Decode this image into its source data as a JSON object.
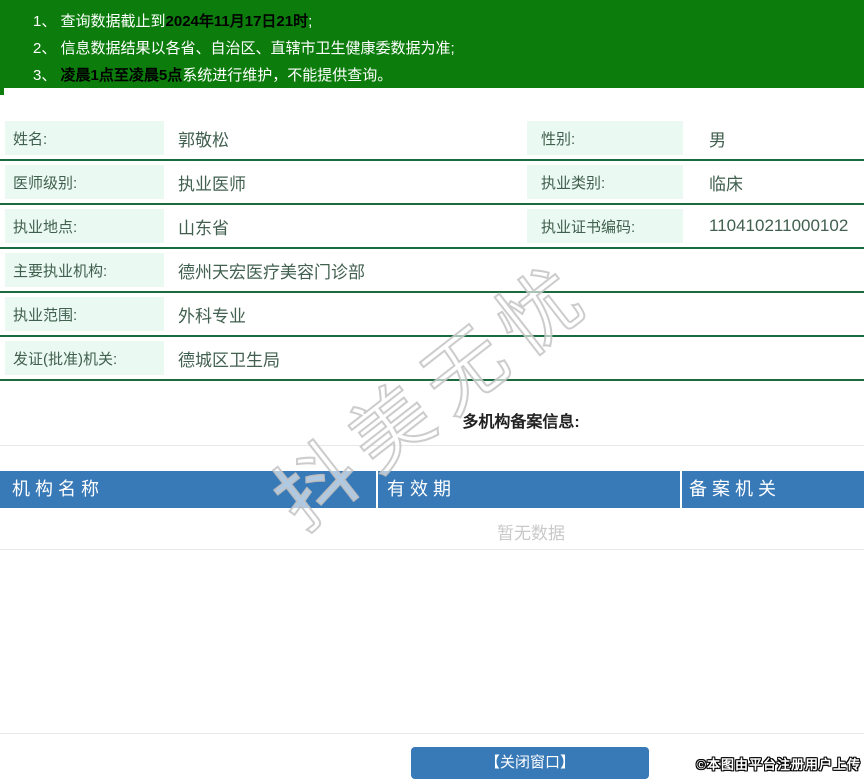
{
  "banner": {
    "items": [
      {
        "prefix": "1、 查询数据截止到",
        "bold": "2024年11月17日21时",
        "suffix": ";"
      },
      {
        "prefix": "2、 信息数据结果以各省、自治区、直辖市卫生健康委数据为准;",
        "bold": "",
        "suffix": ""
      },
      {
        "prefix": "3、 ",
        "bold": "凌晨1点至凌晨5点",
        "suffix": "系统进行维护，不能提供查询。"
      }
    ]
  },
  "doctor": {
    "name_label": "姓名:",
    "name_value": "郭敬松",
    "gender_label": "性别:",
    "gender_value": "男",
    "level_label": "医师级别:",
    "level_value": "执业医师",
    "category_label": "执业类别:",
    "category_value": "临床",
    "location_label": "执业地点:",
    "location_value": "山东省",
    "cert_label": "执业证书编码:",
    "cert_value": "110410211000102",
    "org_label": "主要执业机构:",
    "org_value": "德州天宏医疗美容门诊部",
    "scope_label": "执业范围:",
    "scope_value": "外科专业",
    "issuer_label": "发证(批准)机关:",
    "issuer_value": "德城区卫生局"
  },
  "filing": {
    "title": "多机构备案信息:",
    "columns": [
      "机构名称",
      "有效期",
      "备案机关"
    ],
    "empty_text": "暂无数据"
  },
  "watermark": {
    "text": "抖美无忧"
  },
  "footer": {
    "close_button": "【关闭窗口】",
    "upload_notice": "©本图由平台注册用户上传"
  },
  "colors": {
    "banner_green": "#0c7d0c",
    "header_blue": "#3879b7",
    "row_line_green": "#1a6b40",
    "label_bg": "#eaf9f1",
    "empty_text_gray": "#c9c9c9"
  }
}
